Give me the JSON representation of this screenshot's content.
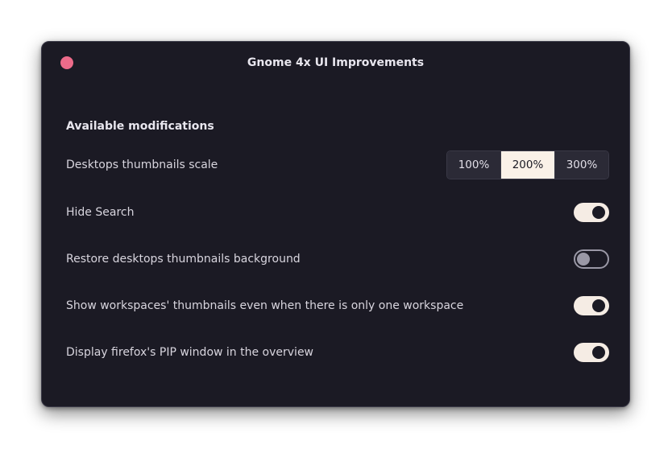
{
  "window": {
    "title": "Gnome 4x UI Improvements"
  },
  "section": {
    "title": "Available modifications"
  },
  "settings": {
    "thumbnails_scale": {
      "label": "Desktops thumbnails scale",
      "options": [
        "100%",
        "200%",
        "300%"
      ],
      "selected": "200%"
    },
    "hide_search": {
      "label": "Hide Search",
      "enabled": true
    },
    "restore_background": {
      "label": "Restore desktops thumbnails background",
      "enabled": false
    },
    "show_single_workspace": {
      "label": "Show workspaces' thumbnails even when there is only one workspace",
      "enabled": true
    },
    "firefox_pip": {
      "label": "Display firefox's PIP window in the overview",
      "enabled": true
    }
  },
  "colors": {
    "window_bg": "#1b1a24",
    "close_button": "#ed6b8a",
    "toggle_on": "#f5ece4",
    "toggle_off_outline": "#9a98a6",
    "segment_active": "#faf1e8"
  }
}
